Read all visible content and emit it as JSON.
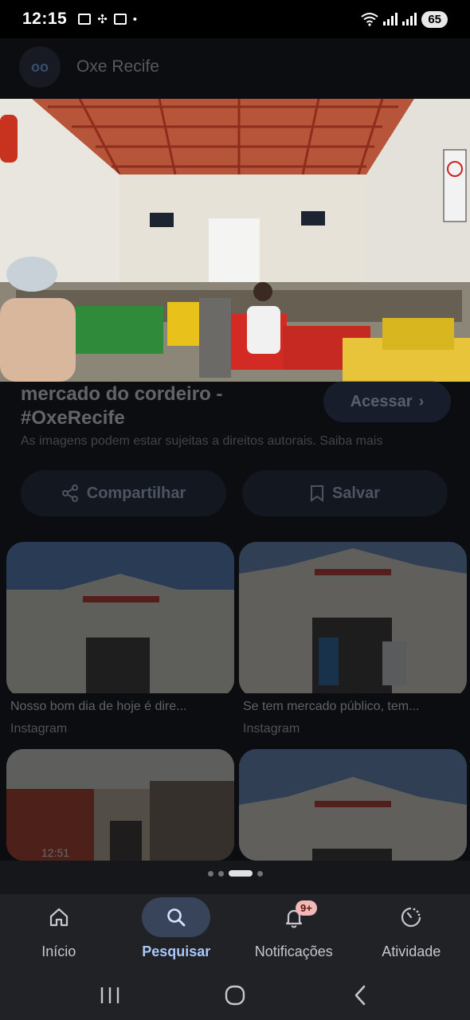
{
  "status": {
    "time": "12:15",
    "dot": "•",
    "battery": "65",
    "icons_left": [
      "pdf-icon",
      "fan-icon",
      "scan-icon"
    ],
    "icons_right": [
      "wifi-icon",
      "signal-icon",
      "signal-icon"
    ]
  },
  "site": {
    "logo_text": "oo",
    "name": "Oxe Recife"
  },
  "result": {
    "title": "mercado do cordeiro - #OxeRecife",
    "access_label": "Acessar",
    "rights_text": "As imagens podem estar sujeitas a direitos autorais. Saiba mais",
    "share_label": "Compartilhar",
    "save_label": "Salvar"
  },
  "grid": [
    {
      "caption": "Nosso bom dia de hoje é dire...",
      "source": "Instagram"
    },
    {
      "caption": "Se tem mercado público, tem...",
      "source": "Instagram"
    },
    {
      "caption": "",
      "source": "",
      "duration": "12:51"
    },
    {
      "caption": "",
      "source": ""
    }
  ],
  "pager": {
    "count": 4,
    "active": 2
  },
  "nav": {
    "items": [
      {
        "label": "Início",
        "icon": "home-icon"
      },
      {
        "label": "Pesquisar",
        "icon": "search-icon"
      },
      {
        "label": "Notificações",
        "icon": "bell-icon",
        "badge": "9+"
      },
      {
        "label": "Atividade",
        "icon": "activity-icon"
      }
    ],
    "active": "Pesquisar"
  },
  "colors": {
    "accent": "#a8c7fa",
    "nav_bg": "#202226",
    "active_pill": "#38445a"
  }
}
